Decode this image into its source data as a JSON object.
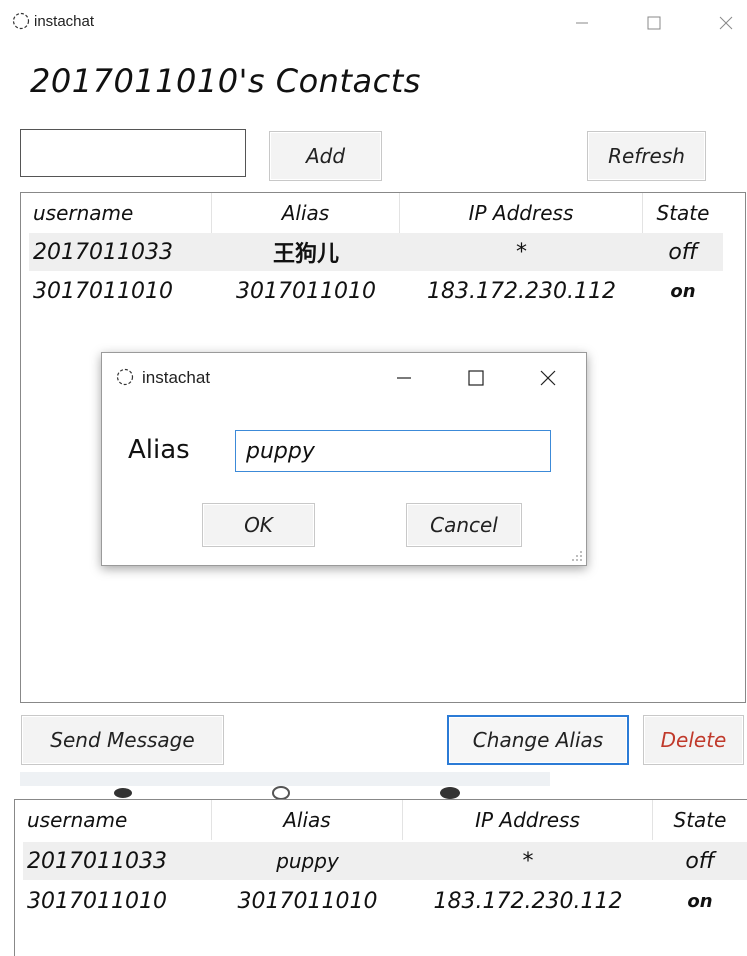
{
  "window": {
    "title": "instachat",
    "controls": [
      "minimize",
      "maximize",
      "close"
    ]
  },
  "heading": "2017011010's Contacts",
  "toolbar": {
    "search_value": "",
    "add_label": "Add",
    "refresh_label": "Refresh"
  },
  "table": {
    "columns": [
      "username",
      "Alias",
      "IP Address",
      "State"
    ],
    "rows": [
      {
        "username": "2017011033",
        "alias": "王狗儿",
        "ip": "*",
        "state": "off"
      },
      {
        "username": "3017011010",
        "alias": "3017011010",
        "ip": "183.172.230.112",
        "state": "on"
      }
    ]
  },
  "dialog": {
    "title": "instachat",
    "alias_label": "Alias",
    "alias_value": "puppy",
    "ok_label": "OK",
    "cancel_label": "Cancel"
  },
  "actions": {
    "send_label": "Send Message",
    "change_alias_label": "Change Alias",
    "delete_label": "Delete"
  },
  "table_after": {
    "columns": [
      "username",
      "Alias",
      "IP Address",
      "State"
    ],
    "rows": [
      {
        "username": "2017011033",
        "alias": "puppy",
        "ip": "*",
        "state": "off"
      },
      {
        "username": "3017011010",
        "alias": "3017011010",
        "ip": "183.172.230.112",
        "state": "on"
      }
    ]
  },
  "colors": {
    "focus_border": "#2b7bd6",
    "delete_text": "#c0392b",
    "selected_row": "#efefef"
  },
  "icons": [
    "instachat-icon",
    "minimize-icon",
    "maximize-icon",
    "close-icon",
    "resize-grip-icon"
  ]
}
